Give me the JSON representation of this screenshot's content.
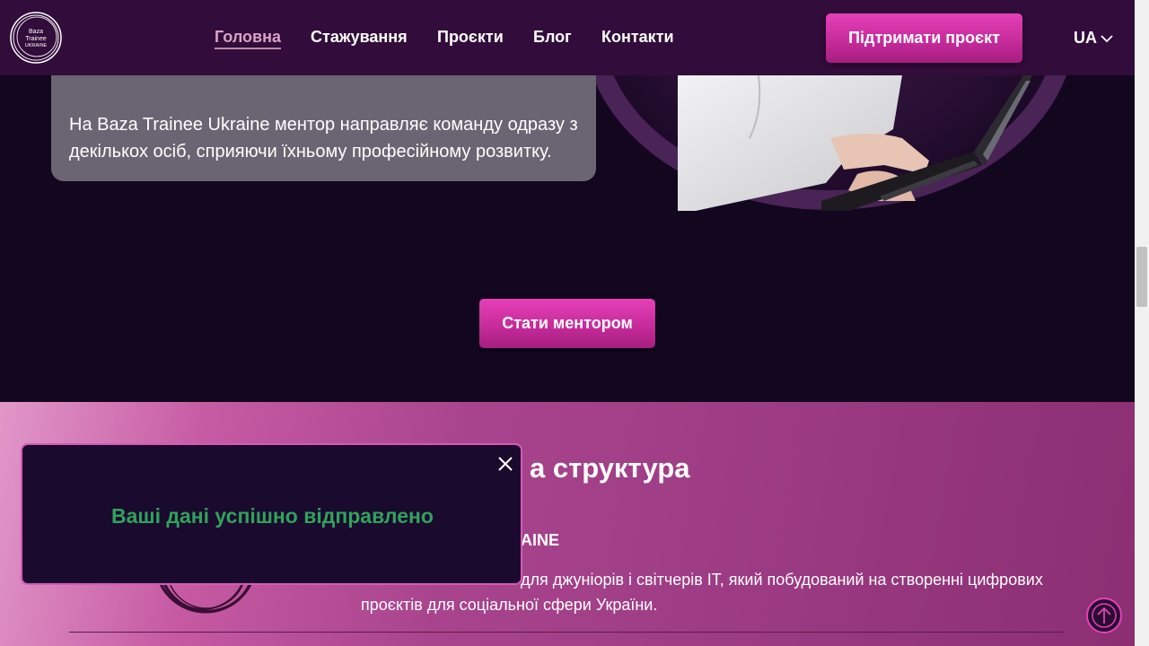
{
  "header": {
    "logo_text": "Baza Trainee Ukraine",
    "nav": [
      {
        "label": "Головна",
        "active": true
      },
      {
        "label": "Стажування",
        "active": false
      },
      {
        "label": "Проєкти",
        "active": false
      },
      {
        "label": "Блог",
        "active": false
      },
      {
        "label": "Контакти",
        "active": false
      }
    ],
    "support_button": "Підтримати проєкт",
    "language": "UA"
  },
  "mentor": {
    "card_text": "На Baza Trainee Ukraine ментор направляє команду одразу з декількох осіб, сприяючи їхньому професійному розвитку.",
    "button": "Стати ментором"
  },
  "structure": {
    "title_partial": "а структура",
    "name_partial": "AINE",
    "desc_line1_partial": "для джуніорів і світчерів IT, який побудований на створенні цифрових",
    "desc_line2": "проєктів для соціальної сфери України."
  },
  "toast": {
    "message": "Ваші дані успішно відправлено"
  },
  "colors": {
    "header_bg": "#320c3a",
    "page_bg": "#13061f",
    "accent": "#d635aa",
    "success": "#2fa35a"
  }
}
